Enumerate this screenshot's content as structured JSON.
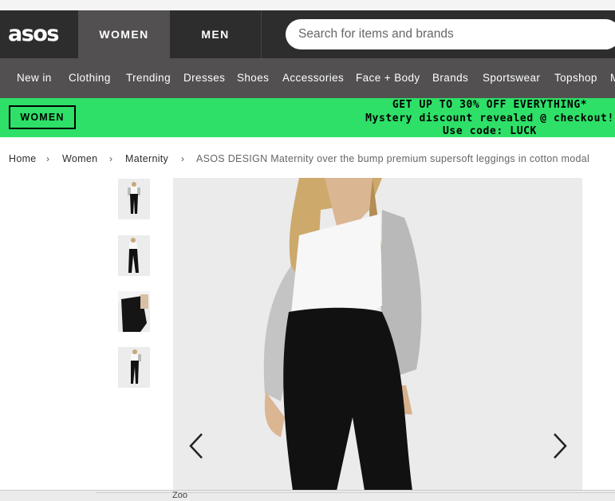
{
  "header": {
    "logo": "asos",
    "tabs": [
      "WOMEN",
      "MEN"
    ],
    "search_placeholder": "Search for items and brands"
  },
  "nav": {
    "items": [
      "New in",
      "Clothing",
      "Trending",
      "Dresses",
      "Shoes",
      "Accessories",
      "Face + Body",
      "Brands",
      "Sportswear",
      "Topshop",
      "M"
    ]
  },
  "promo": {
    "button": "WOMEN",
    "line1": "GET UP TO 30% OFF EVERYTHING*",
    "line2": "Mystery discount revealed @ checkout!",
    "line3": "Use code: LUCK",
    "color": "#2ee068"
  },
  "breadcrumb": {
    "items": [
      "Home",
      "Women",
      "Maternity"
    ],
    "separator": "›",
    "current": "ASOS DESIGN Maternity over the bump premium supersoft leggings in cotton modal"
  },
  "gallery": {
    "thumbnail_count": 4,
    "prev_icon": "chevron-left-icon",
    "next_icon": "chevron-right-icon"
  },
  "footer_peek": "Zoo"
}
